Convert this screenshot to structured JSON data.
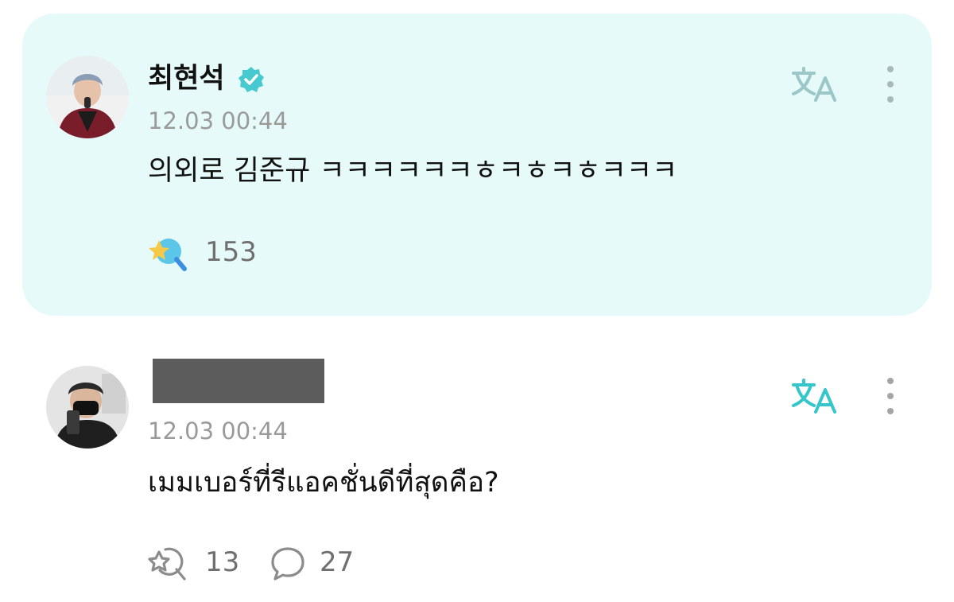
{
  "post": {
    "author": "최현석",
    "verified": true,
    "timestamp": "12.03 00:44",
    "text": "의외로 김준규 ㅋㅋㅋㅋㅋㅋㅎㅋㅎㅋㅎㅋㅋㅋ",
    "reaction_count": "153",
    "translate_icon": "translate-icon",
    "more_icon": "more-vertical-icon",
    "reaction_icon": "cheer-star-icon-filled",
    "background_color": "#e6fbf9",
    "accent_color": "#3ec7cb"
  },
  "comment": {
    "author_redacted": true,
    "timestamp": "12.03 00:44",
    "text": "เมมเบอร์ที่รีแอคชั่นดีที่สุดคือ?",
    "reaction_count": "13",
    "reply_count": "27",
    "translate_icon": "translate-icon",
    "more_icon": "more-vertical-icon",
    "reaction_icon": "cheer-star-icon-outline",
    "reply_icon": "speech-bubble-icon"
  }
}
